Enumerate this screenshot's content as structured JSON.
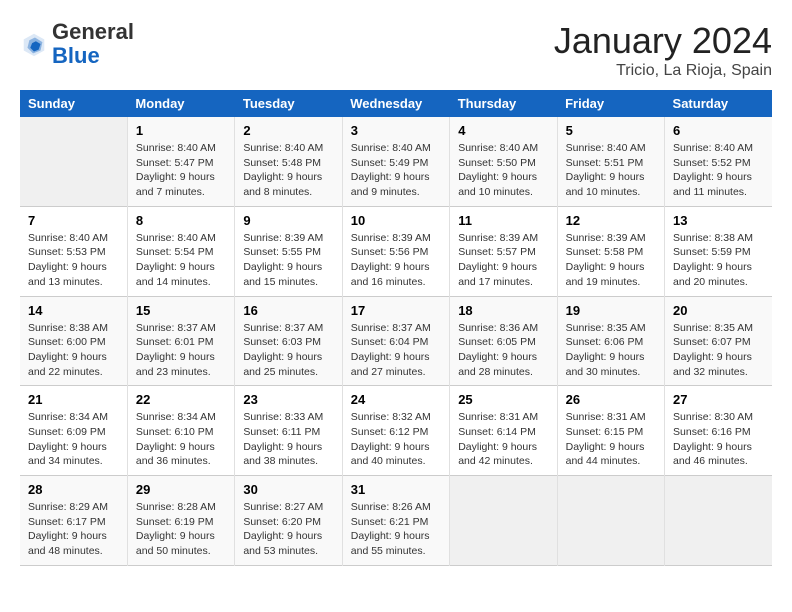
{
  "header": {
    "logo_general": "General",
    "logo_blue": "Blue",
    "month_title": "January 2024",
    "location": "Tricio, La Rioja, Spain"
  },
  "weekdays": [
    "Sunday",
    "Monday",
    "Tuesday",
    "Wednesday",
    "Thursday",
    "Friday",
    "Saturday"
  ],
  "weeks": [
    [
      {
        "day": "",
        "empty": true
      },
      {
        "day": "1",
        "sunrise": "Sunrise: 8:40 AM",
        "sunset": "Sunset: 5:47 PM",
        "daylight": "Daylight: 9 hours and 7 minutes."
      },
      {
        "day": "2",
        "sunrise": "Sunrise: 8:40 AM",
        "sunset": "Sunset: 5:48 PM",
        "daylight": "Daylight: 9 hours and 8 minutes."
      },
      {
        "day": "3",
        "sunrise": "Sunrise: 8:40 AM",
        "sunset": "Sunset: 5:49 PM",
        "daylight": "Daylight: 9 hours and 9 minutes."
      },
      {
        "day": "4",
        "sunrise": "Sunrise: 8:40 AM",
        "sunset": "Sunset: 5:50 PM",
        "daylight": "Daylight: 9 hours and 10 minutes."
      },
      {
        "day": "5",
        "sunrise": "Sunrise: 8:40 AM",
        "sunset": "Sunset: 5:51 PM",
        "daylight": "Daylight: 9 hours and 10 minutes."
      },
      {
        "day": "6",
        "sunrise": "Sunrise: 8:40 AM",
        "sunset": "Sunset: 5:52 PM",
        "daylight": "Daylight: 9 hours and 11 minutes."
      }
    ],
    [
      {
        "day": "7",
        "sunrise": "Sunrise: 8:40 AM",
        "sunset": "Sunset: 5:53 PM",
        "daylight": "Daylight: 9 hours and 13 minutes."
      },
      {
        "day": "8",
        "sunrise": "Sunrise: 8:40 AM",
        "sunset": "Sunset: 5:54 PM",
        "daylight": "Daylight: 9 hours and 14 minutes."
      },
      {
        "day": "9",
        "sunrise": "Sunrise: 8:39 AM",
        "sunset": "Sunset: 5:55 PM",
        "daylight": "Daylight: 9 hours and 15 minutes."
      },
      {
        "day": "10",
        "sunrise": "Sunrise: 8:39 AM",
        "sunset": "Sunset: 5:56 PM",
        "daylight": "Daylight: 9 hours and 16 minutes."
      },
      {
        "day": "11",
        "sunrise": "Sunrise: 8:39 AM",
        "sunset": "Sunset: 5:57 PM",
        "daylight": "Daylight: 9 hours and 17 minutes."
      },
      {
        "day": "12",
        "sunrise": "Sunrise: 8:39 AM",
        "sunset": "Sunset: 5:58 PM",
        "daylight": "Daylight: 9 hours and 19 minutes."
      },
      {
        "day": "13",
        "sunrise": "Sunrise: 8:38 AM",
        "sunset": "Sunset: 5:59 PM",
        "daylight": "Daylight: 9 hours and 20 minutes."
      }
    ],
    [
      {
        "day": "14",
        "sunrise": "Sunrise: 8:38 AM",
        "sunset": "Sunset: 6:00 PM",
        "daylight": "Daylight: 9 hours and 22 minutes."
      },
      {
        "day": "15",
        "sunrise": "Sunrise: 8:37 AM",
        "sunset": "Sunset: 6:01 PM",
        "daylight": "Daylight: 9 hours and 23 minutes."
      },
      {
        "day": "16",
        "sunrise": "Sunrise: 8:37 AM",
        "sunset": "Sunset: 6:03 PM",
        "daylight": "Daylight: 9 hours and 25 minutes."
      },
      {
        "day": "17",
        "sunrise": "Sunrise: 8:37 AM",
        "sunset": "Sunset: 6:04 PM",
        "daylight": "Daylight: 9 hours and 27 minutes."
      },
      {
        "day": "18",
        "sunrise": "Sunrise: 8:36 AM",
        "sunset": "Sunset: 6:05 PM",
        "daylight": "Daylight: 9 hours and 28 minutes."
      },
      {
        "day": "19",
        "sunrise": "Sunrise: 8:35 AM",
        "sunset": "Sunset: 6:06 PM",
        "daylight": "Daylight: 9 hours and 30 minutes."
      },
      {
        "day": "20",
        "sunrise": "Sunrise: 8:35 AM",
        "sunset": "Sunset: 6:07 PM",
        "daylight": "Daylight: 9 hours and 32 minutes."
      }
    ],
    [
      {
        "day": "21",
        "sunrise": "Sunrise: 8:34 AM",
        "sunset": "Sunset: 6:09 PM",
        "daylight": "Daylight: 9 hours and 34 minutes."
      },
      {
        "day": "22",
        "sunrise": "Sunrise: 8:34 AM",
        "sunset": "Sunset: 6:10 PM",
        "daylight": "Daylight: 9 hours and 36 minutes."
      },
      {
        "day": "23",
        "sunrise": "Sunrise: 8:33 AM",
        "sunset": "Sunset: 6:11 PM",
        "daylight": "Daylight: 9 hours and 38 minutes."
      },
      {
        "day": "24",
        "sunrise": "Sunrise: 8:32 AM",
        "sunset": "Sunset: 6:12 PM",
        "daylight": "Daylight: 9 hours and 40 minutes."
      },
      {
        "day": "25",
        "sunrise": "Sunrise: 8:31 AM",
        "sunset": "Sunset: 6:14 PM",
        "daylight": "Daylight: 9 hours and 42 minutes."
      },
      {
        "day": "26",
        "sunrise": "Sunrise: 8:31 AM",
        "sunset": "Sunset: 6:15 PM",
        "daylight": "Daylight: 9 hours and 44 minutes."
      },
      {
        "day": "27",
        "sunrise": "Sunrise: 8:30 AM",
        "sunset": "Sunset: 6:16 PM",
        "daylight": "Daylight: 9 hours and 46 minutes."
      }
    ],
    [
      {
        "day": "28",
        "sunrise": "Sunrise: 8:29 AM",
        "sunset": "Sunset: 6:17 PM",
        "daylight": "Daylight: 9 hours and 48 minutes."
      },
      {
        "day": "29",
        "sunrise": "Sunrise: 8:28 AM",
        "sunset": "Sunset: 6:19 PM",
        "daylight": "Daylight: 9 hours and 50 minutes."
      },
      {
        "day": "30",
        "sunrise": "Sunrise: 8:27 AM",
        "sunset": "Sunset: 6:20 PM",
        "daylight": "Daylight: 9 hours and 53 minutes."
      },
      {
        "day": "31",
        "sunrise": "Sunrise: 8:26 AM",
        "sunset": "Sunset: 6:21 PM",
        "daylight": "Daylight: 9 hours and 55 minutes."
      },
      {
        "day": "",
        "empty": true
      },
      {
        "day": "",
        "empty": true
      },
      {
        "day": "",
        "empty": true
      }
    ]
  ]
}
